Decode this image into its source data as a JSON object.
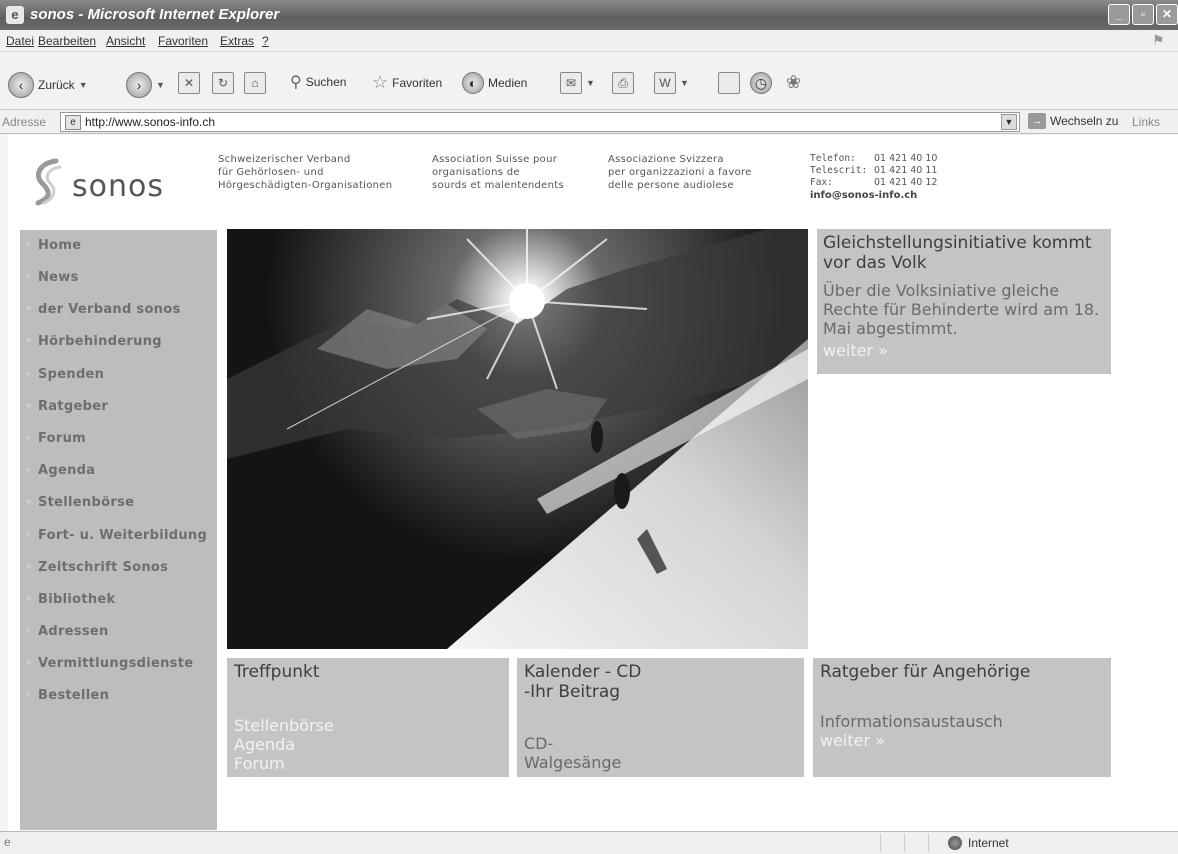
{
  "window": {
    "title": "sonos - Microsoft Internet Explorer",
    "app_icon": "ie-page-icon",
    "controls": [
      "minimize-icon",
      "maximize-icon",
      "close-icon"
    ]
  },
  "menu": {
    "items": [
      "Datei",
      "Bearbeiten",
      "Ansicht",
      "Favoriten",
      "Extras",
      "?"
    ]
  },
  "toolbar": {
    "back_label": "Zurück",
    "search_label": "Suchen",
    "favorites_label": "Favoriten",
    "media_label": "Medien"
  },
  "address": {
    "label": "Adresse",
    "url": "http://www.sonos-info.ch",
    "go_label": "Wechseln zu",
    "links_label": "Links"
  },
  "site": {
    "logo_text": "sonos",
    "assoc": [
      [
        "Schweizerischer Verband",
        "für Gehörlosen- und",
        "Hörgeschädigten-Organisationen"
      ],
      [
        "Association Suisse pour",
        "organisations de",
        "sourds et malentendents"
      ],
      [
        "Associazione Svizzera",
        "per organizzazioni a favore",
        "delle persone audiolese"
      ]
    ],
    "contact": {
      "phone_label": "Telefon:",
      "phone": "01 421 40 10",
      "telescrit_label": "Telescrit:",
      "telescrit": "01 421 40 11",
      "fax_label": "Fax:",
      "fax": "01 421 40 12",
      "email": "info@sonos-info.ch"
    },
    "nav": [
      {
        "label": "Home",
        "bullet": "›"
      },
      {
        "label": "News",
        "bullet": "›"
      },
      {
        "label": "der Verband sonos",
        "bullet": "»"
      },
      {
        "label": "Hörbehinderung",
        "bullet": "»"
      },
      {
        "label": "Spenden",
        "bullet": "›"
      },
      {
        "label": "Ratgeber",
        "bullet": "»"
      },
      {
        "label": "Forum",
        "bullet": "›"
      },
      {
        "label": "Agenda",
        "bullet": "›"
      },
      {
        "label": "Stellenbörse",
        "bullet": "»"
      },
      {
        "label": "Fort- u. Weiterbildung",
        "bullet": "›"
      },
      {
        "label": "Zeitschrift Sonos",
        "bullet": "»"
      },
      {
        "label": "Bibliothek",
        "bullet": "»"
      },
      {
        "label": "Adressen",
        "bullet": "›"
      },
      {
        "label": "Vermittlungsdienste",
        "bullet": "»"
      },
      {
        "label": "Bestellen",
        "bullet": "›"
      }
    ],
    "feature": {
      "heading": "Gleichstellungsinitiative kommt vor das Volk",
      "text": "Über die Volksiniative gleiche Rechte für Behinderte wird am 18. Mai abgestimmt.",
      "more": "weiter »"
    },
    "boxes": {
      "treffpunkt": {
        "heading": "Treffpunkt",
        "links": [
          "Stellenbörse",
          "Agenda",
          "Forum"
        ]
      },
      "kalender": {
        "heading_1": "Kalender - CD",
        "heading_2": "-Ihr Beitrag",
        "text_1": "CD-",
        "text_2": "Walgesänge"
      },
      "ratgeber": {
        "heading": "Ratgeber für Angehörige",
        "text": "Informationsaustausch",
        "more": "weiter »"
      }
    }
  },
  "status": {
    "zone": "Internet"
  }
}
